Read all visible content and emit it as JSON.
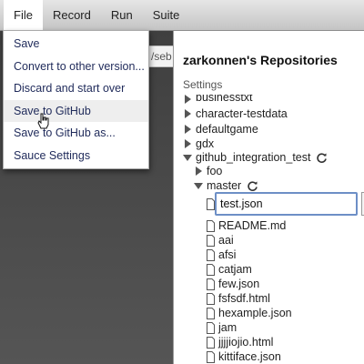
{
  "menubar": {
    "items": [
      {
        "label": "File",
        "active": true
      },
      {
        "label": "Record",
        "active": false
      },
      {
        "label": "Run",
        "active": false
      },
      {
        "label": "Suite",
        "active": false
      }
    ]
  },
  "url_fragment": "/seb",
  "file_menu": {
    "items": [
      {
        "label": "Save"
      },
      {
        "label": "Convert to other version..."
      },
      {
        "label": "Discard and start over"
      },
      {
        "label": "Save to GitHub",
        "hovered": true
      },
      {
        "label": "Save to GitHub as..."
      },
      {
        "label": "Sauce Settings"
      }
    ]
  },
  "panel": {
    "title": "zarkonnen's Repositories",
    "settings_label": "Settings",
    "repos": [
      {
        "label": "businesstxt",
        "expanded": false
      },
      {
        "label": "character-testdata",
        "expanded": false
      },
      {
        "label": "defaultgame",
        "expanded": false
      },
      {
        "label": "gdx",
        "expanded": false
      },
      {
        "label": "github_integration_test",
        "expanded": true,
        "sync_icon": true
      }
    ],
    "branches": [
      {
        "label": "foo",
        "expanded": false
      },
      {
        "label": "master",
        "expanded": true,
        "sync_icon": true
      }
    ],
    "new_file_input": {
      "value": "test.json"
    },
    "files": [
      "README.md",
      "aai",
      "afsi",
      "catjam",
      "few.json",
      "fsfsdf.html",
      "hexample.json",
      "jam",
      "jjjjiojio.html",
      "kittiface.json"
    ]
  },
  "colors": {
    "menu_text": "#1f2a5a",
    "edit_border": "#6d8fc6",
    "workspace": "#4a4a4a"
  }
}
